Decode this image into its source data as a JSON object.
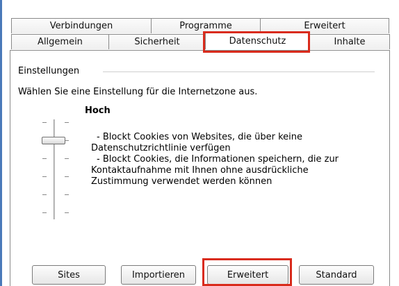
{
  "tabs": {
    "back_row": [
      {
        "label": "Verbindungen"
      },
      {
        "label": "Programme"
      },
      {
        "label": "Erweitert"
      }
    ],
    "front_row": [
      {
        "label": "Allgemein"
      },
      {
        "label": "Sicherheit"
      },
      {
        "label": "Datenschutz",
        "selected": true
      },
      {
        "label": "Inhalte"
      }
    ]
  },
  "settings": {
    "section_title": "Einstellungen",
    "intro": "Wählen Sie eine Einstellung für die Internetzone aus.",
    "level_title": "Hoch",
    "slider": {
      "positions": 6,
      "current_position_from_top": 1
    },
    "description_lines": [
      "- Blockt Cookies von Websites, die über keine",
      "Datenschutzrichtlinie verfügen",
      "- Blockt Cookies, die Informationen speichern, die zur",
      "Kontaktaufnahme mit Ihnen ohne ausdrückliche",
      "Zustimmung verwendet werden können"
    ]
  },
  "buttons": {
    "sites": "Sites",
    "importieren": "Importieren",
    "erweitert": "Erweitert",
    "standard": "Standard"
  },
  "colors": {
    "highlight": "#d92b1c",
    "left_edge": "#4a79b9"
  }
}
